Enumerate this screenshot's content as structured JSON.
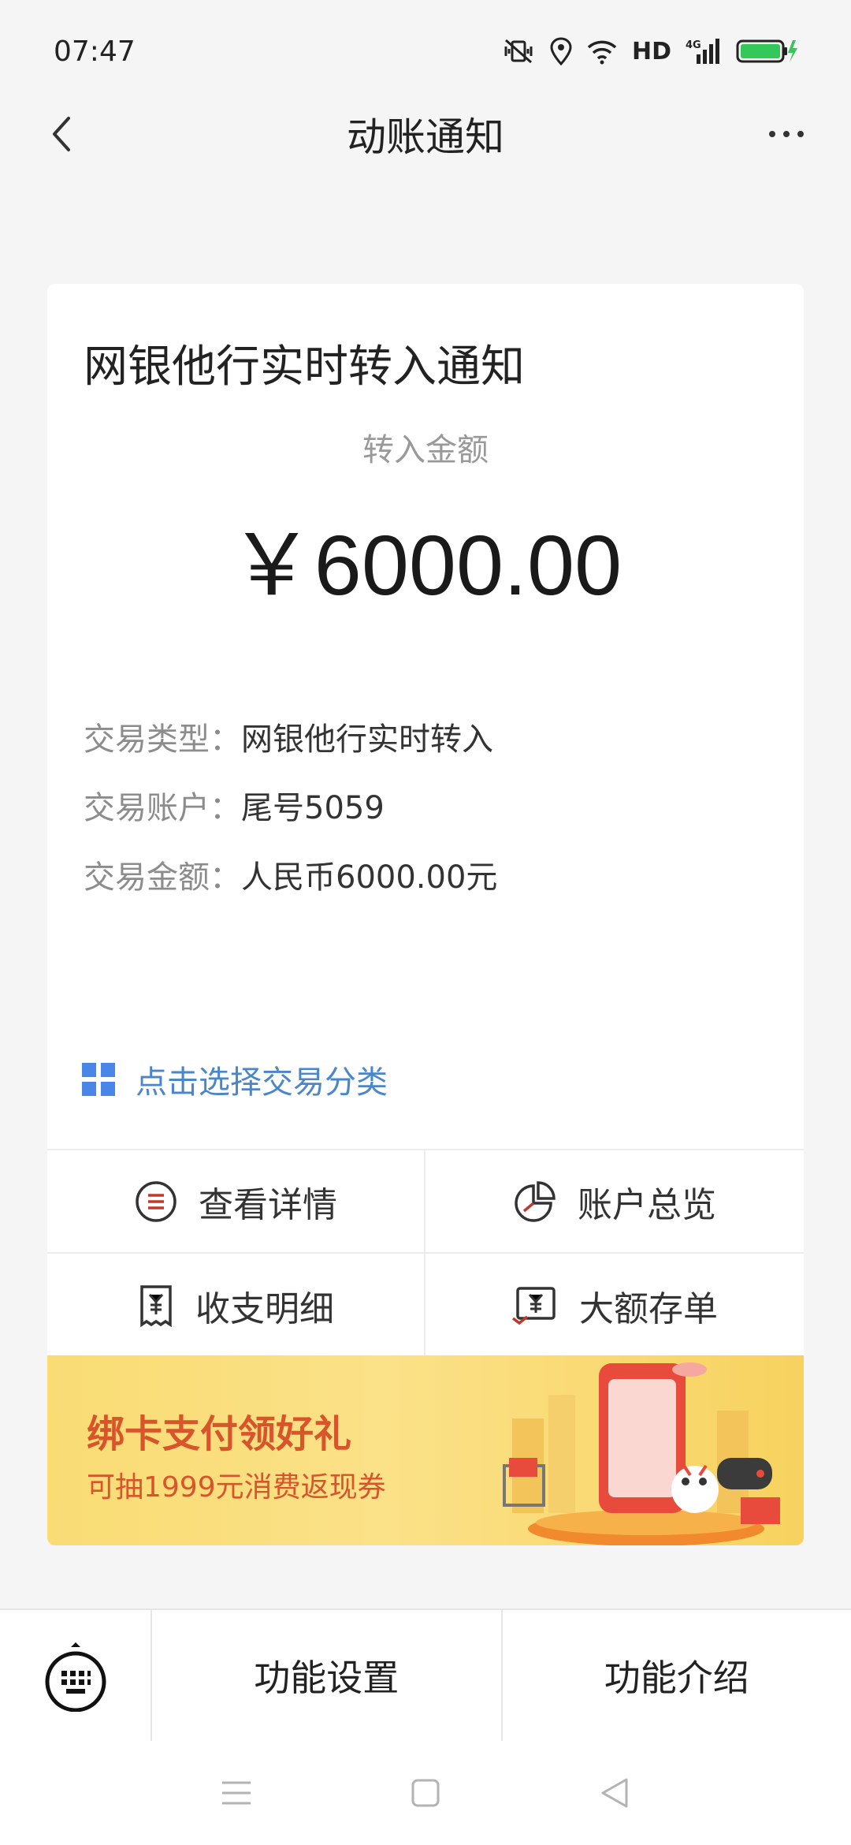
{
  "status_bar": {
    "time": "07:47",
    "network": "HD",
    "signal_type": "4G",
    "battery_color": "#34c759"
  },
  "nav": {
    "title": "动账通知"
  },
  "card": {
    "title": "网银他行实时转入通知",
    "amount_label": "转入金额",
    "amount_value": "￥6000.00",
    "rows": [
      {
        "key": "交易类型：",
        "value": "网银他行实时转入"
      },
      {
        "key": "交易账户：",
        "value": "尾号5059"
      },
      {
        "key": "交易金额：",
        "value": "人民币6000.00元"
      }
    ],
    "category_link": "点击选择交易分类",
    "actions": [
      {
        "label": "查看详情",
        "icon": "list-circle-icon"
      },
      {
        "label": "账户总览",
        "icon": "pie-chart-icon"
      },
      {
        "label": "收支明细",
        "icon": "receipt-icon"
      },
      {
        "label": "大额存单",
        "icon": "certificate-icon"
      }
    ]
  },
  "banner": {
    "title": "绑卡支付领好礼",
    "subtitle": "可抽1999元消费返现券",
    "accent_color": "#d8542a"
  },
  "bottom_menu": {
    "items": [
      "功能设置",
      "功能介绍"
    ]
  },
  "colors": {
    "link": "#4a86c8",
    "background": "#f5f5f5"
  }
}
